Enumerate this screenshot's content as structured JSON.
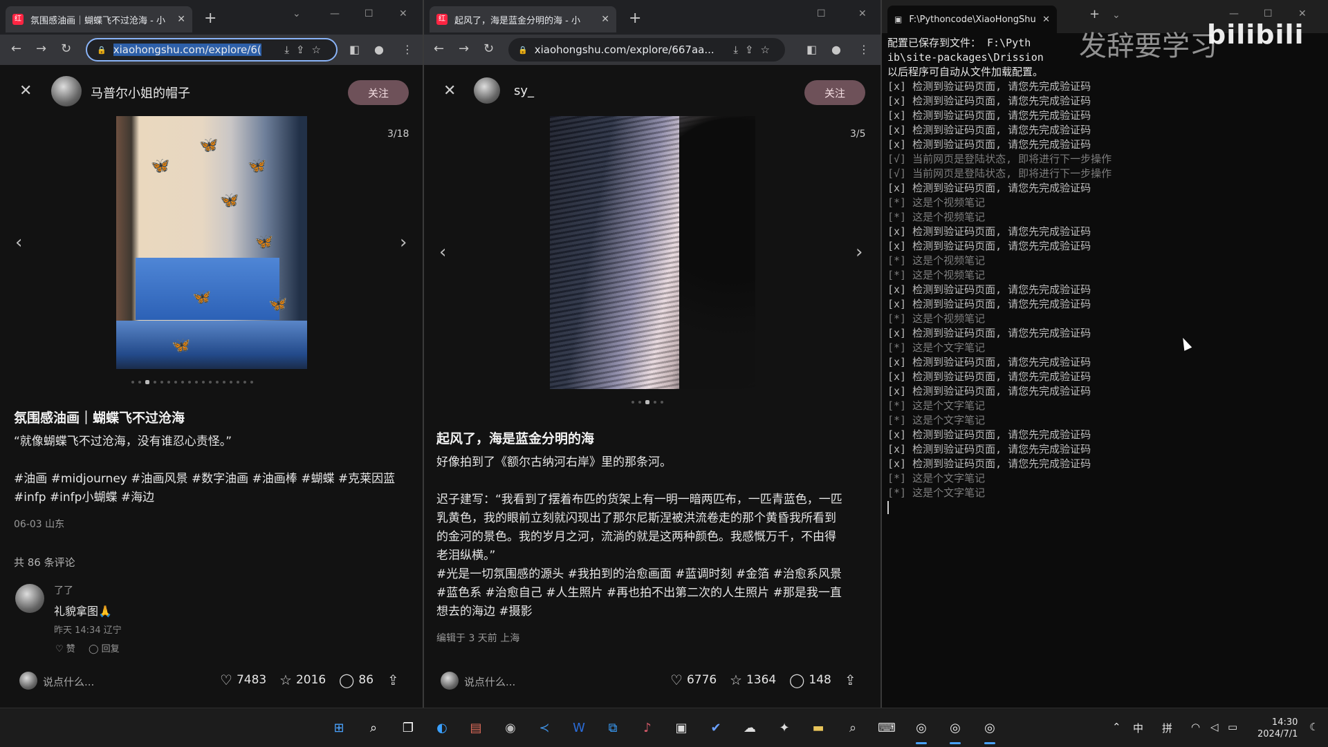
{
  "browser_left": {
    "tab_title": "氛围感油画｜蝴蝶飞不过沧海 - 小",
    "url": "xiaohongshu.com/explore/6(",
    "author": "马普尔小姐的帽子",
    "follow": "关注",
    "counter": "3/18",
    "title": "氛围感油画｜蝴蝶飞不过沧海",
    "quote": "“就像蝴蝶飞不过沧海，没有谁忍心责怪。”",
    "tags_line1": "#油画 #midjourney #油画风景 #数字油画 #油画棒 #蝴蝶 #克莱因蓝",
    "tags_line2": "#infp #infp小蝴蝶 #海边",
    "date_loc": "06-03 山东",
    "comment_count": "共 86 条评论",
    "comment": {
      "name": "了了",
      "text": "礼貌拿图🙏",
      "meta": "昨天 14:34 辽宁",
      "like": "♡ 赞",
      "reply": "◯ 回复"
    },
    "say": "说点什么...",
    "likes": "7483",
    "stars": "2016",
    "comments": "86"
  },
  "browser_mid": {
    "tab_title": "起风了，海是蓝金分明的海 - 小",
    "url": "xiaohongshu.com/explore/667aa...",
    "author": "sy_",
    "follow": "关注",
    "counter": "3/5",
    "title": "起风了，海是蓝金分明的海",
    "line1": "好像拍到了《额尔古纳河右岸》里的那条河。",
    "para": [
      "迟子建写：“我看到了摆着布匹的货架上有一明一暗两匹布，一匹青蓝色，一匹",
      "乳黄色，我的眼前立刻就闪现出了那尔尼斯涅被洪流卷走的那个黄昏我所看到",
      "的金河的景色。我的岁月之河，流淌的就是这两种颜色。我感慨万千，不由得",
      "老泪纵横。”"
    ],
    "tags": [
      "#光是一切氛围感的源头 #我拍到的治愈画面 #蓝调时刻 #金箔 #治愈系风景",
      "#蓝色系 #治愈自己 #人生照片 #再也拍不出第二次的人生照片 #那是我一直",
      "想去的海边 #摄影"
    ],
    "edited": "编辑于 3 天前 上海",
    "say": "说点什么...",
    "likes": "6776",
    "stars": "1364",
    "comments": "148"
  },
  "terminal": {
    "tab_title": "F:\\Pythoncode\\XiaoHongShu",
    "lines": [
      {
        "t": "配置已保存到文件： F:\\Pyth",
        "c": "#e6e6e6"
      },
      {
        "t": "ib\\site-packages\\Drission",
        "c": "#e6e6e6"
      },
      {
        "t": "以后程序可自动从文件加载配置。",
        "c": "#e6e6e6"
      },
      {
        "t": "[x] 检测到验证码页面, 请您先完成验证码",
        "c": "#bdbdbd"
      },
      {
        "t": "[x] 检测到验证码页面, 请您先完成验证码",
        "c": "#bdbdbd"
      },
      {
        "t": "[x] 检测到验证码页面, 请您先完成验证码",
        "c": "#bdbdbd"
      },
      {
        "t": "[x] 检测到验证码页面, 请您先完成验证码",
        "c": "#bdbdbd"
      },
      {
        "t": "[x] 检测到验证码页面, 请您先完成验证码",
        "c": "#bdbdbd"
      },
      {
        "t": "[√] 当前网页是登陆状态, 即将进行下一步操作",
        "c": "#7e7e7e"
      },
      {
        "t": "[√] 当前网页是登陆状态, 即将进行下一步操作",
        "c": "#7e7e7e"
      },
      {
        "t": "[x] 检测到验证码页面, 请您先完成验证码",
        "c": "#bdbdbd"
      },
      {
        "t": "[*] 这是个视频笔记",
        "c": "#7e7e7e"
      },
      {
        "t": "[*] 这是个视频笔记",
        "c": "#7e7e7e"
      },
      {
        "t": "[x] 检测到验证码页面, 请您先完成验证码",
        "c": "#bdbdbd"
      },
      {
        "t": "[x] 检测到验证码页面, 请您先完成验证码",
        "c": "#bdbdbd"
      },
      {
        "t": "[*] 这是个视频笔记",
        "c": "#7e7e7e"
      },
      {
        "t": "[*] 这是个视频笔记",
        "c": "#7e7e7e"
      },
      {
        "t": "[x] 检测到验证码页面, 请您先完成验证码",
        "c": "#bdbdbd"
      },
      {
        "t": "[x] 检测到验证码页面, 请您先完成验证码",
        "c": "#bdbdbd"
      },
      {
        "t": "[*] 这是个视频笔记",
        "c": "#7e7e7e"
      },
      {
        "t": "[x] 检测到验证码页面, 请您先完成验证码",
        "c": "#bdbdbd"
      },
      {
        "t": "[*] 这是个文字笔记",
        "c": "#7e7e7e"
      },
      {
        "t": "[x] 检测到验证码页面, 请您先完成验证码",
        "c": "#bdbdbd"
      },
      {
        "t": "[x] 检测到验证码页面, 请您先完成验证码",
        "c": "#bdbdbd"
      },
      {
        "t": "[x] 检测到验证码页面, 请您先完成验证码",
        "c": "#bdbdbd"
      },
      {
        "t": "[*] 这是个文字笔记",
        "c": "#7e7e7e"
      },
      {
        "t": "[*] 这是个文字笔记",
        "c": "#7e7e7e"
      },
      {
        "t": "[x] 检测到验证码页面, 请您先完成验证码",
        "c": "#bdbdbd"
      },
      {
        "t": "[x] 检测到验证码页面, 请您先完成验证码",
        "c": "#bdbdbd"
      },
      {
        "t": "[x] 检测到验证码页面, 请您先完成验证码",
        "c": "#bdbdbd"
      },
      {
        "t": "[*] 这是个文字笔记",
        "c": "#7e7e7e"
      },
      {
        "t": "[*] 这是个文字笔记",
        "c": "#7e7e7e"
      }
    ]
  },
  "watermark": {
    "brand": "bilibili",
    "cn": "发辞要学习"
  },
  "taskbar": {
    "ime_lang": "中",
    "ime_mode": "拼",
    "time": "14:30",
    "date": "2024/7/1"
  },
  "colors": {
    "follow_bg": "#6e5159",
    "accent": "#ff2442",
    "url_sel": "#2d5fa8"
  }
}
